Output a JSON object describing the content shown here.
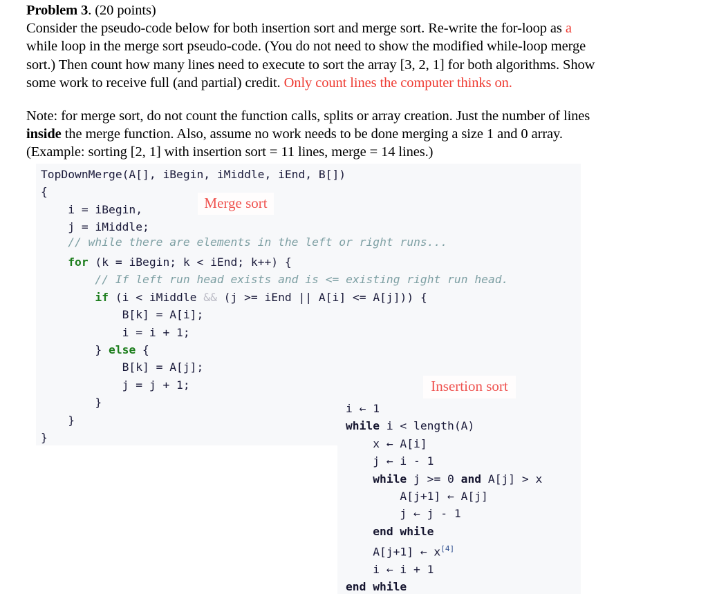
{
  "document": {
    "problem_heading": "Problem 3",
    "problem_points": ". (20 points)",
    "paragraph1": {
      "seg1": "Consider the pseudo-code below for both insertion sort and merge sort.  Re-write the for-loop as ",
      "seg2_red": "a",
      "seg3": "while loop in the merge sort pseudo-code.  (You do not need to show the modified while-loop merge",
      "seg4": "sort.)   Then count how many lines need to execute to sort the array [3, 2, 1] for both algorithms.  Show",
      "seg5": "some work to receive full (and partial) credit.  ",
      "seg6_red": "Only count lines the computer thinks on."
    },
    "paragraph2": {
      "line1": "Note: for merge sort, do not count the function calls, splits or array creation.  Just the number of lines",
      "line2_bold": "inside",
      "line2_rest": " the merge function.  Also, assume no work needs to be done merging a size 1 and 0 array.",
      "line3": "(Example: sorting [2, 1] with insertion sort = 11 lines, merge = 14 lines.)"
    }
  },
  "callouts": {
    "merge_label": "Merge sort",
    "insertion_label": "Insertion sort",
    "label_color": "#ef5350"
  },
  "merge_sort_code": {
    "signature": "TopDownMerge(A[], iBegin, iMiddle, iEnd, B[])",
    "open_brace": "{",
    "l_i_init": "    i = iBegin,",
    "l_j_init": "    j = iMiddle;",
    "comment_while": "    // while there are elements in the left or right runs...",
    "for_kw": "    for",
    "for_rest": " (k = iBegin; k < iEnd; k++) {",
    "comment_if": "        // If left run head exists and is <= existing right run head.",
    "if_kw": "        if",
    "if_p1": " (i < iMiddle ",
    "if_amp": "&&",
    "if_p2": " (j >= iEnd || A[i] <= A[j])) {",
    "l_bk_ai": "            B[k] = A[i];",
    "l_i_inc": "            i = i + 1;",
    "else_pre": "        } ",
    "else_kw": "else",
    "else_post": " {",
    "l_bk_aj": "            B[k] = A[j];",
    "l_j_inc": "            j = j + 1;",
    "close_if": "        }",
    "close_for": "    }",
    "close_fn": "}"
  },
  "insertion_sort_code": {
    "l1": "i ← 1",
    "l2_kw": "while",
    "l2_rest": " i < length(A)",
    "l3": "    x ← A[i]",
    "l4": "    j ← i - 1",
    "l5_pre": "    ",
    "l5_kw": "while",
    "l5_mid": " j >= 0 ",
    "l5_and": "and",
    "l5_post": " A[j] > x",
    "l6": "        A[j+1] ← A[j]",
    "l7": "        j ← j - 1",
    "l8_pad": "    ",
    "l8_kw": "end while",
    "l9": "    A[j+1] ← x",
    "l9_sup": "[4]",
    "l10": "    i ← i + 1",
    "l11_kw": "end while"
  },
  "colors": {
    "panel_bg": "#f7f8fa",
    "keyword_green": "#1c7d1c",
    "comment_teal": "#7d9fa3",
    "code_text": "#1a1a3a",
    "red_text": "#ee3b32"
  }
}
